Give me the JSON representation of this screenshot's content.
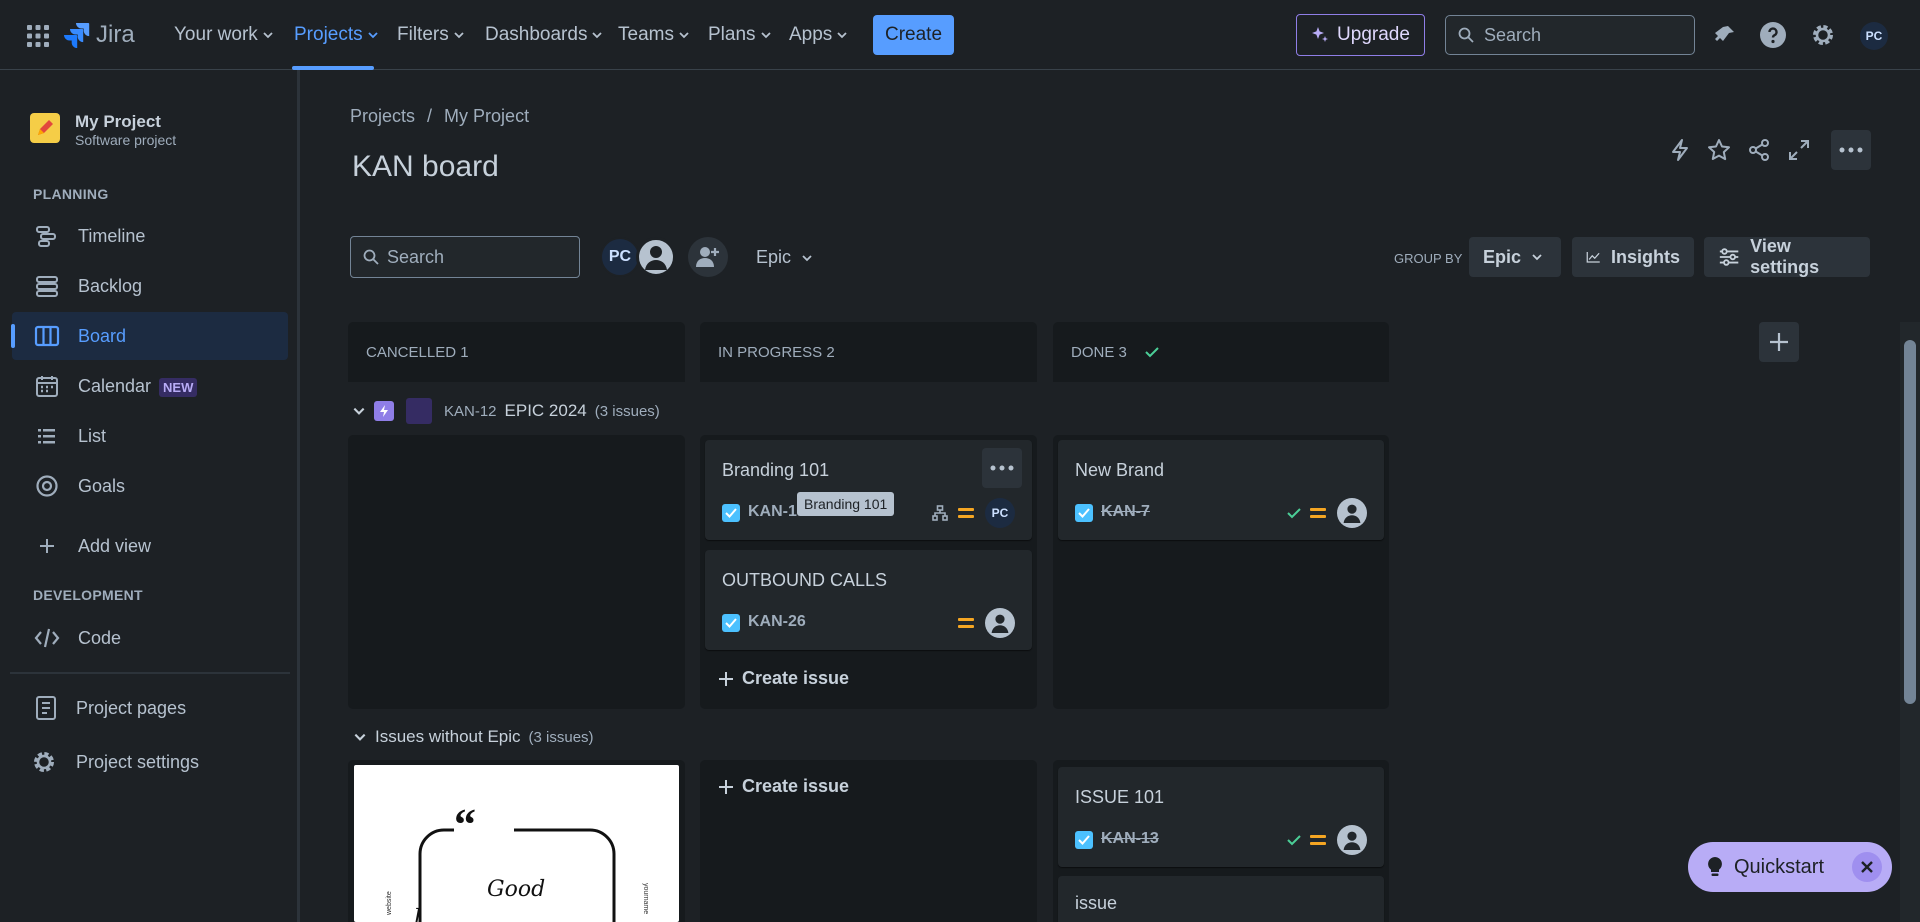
{
  "nav": {
    "product": "Jira",
    "items": [
      "Your work",
      "Projects",
      "Filters",
      "Dashboards",
      "Teams",
      "Plans",
      "Apps"
    ],
    "create": "Create",
    "upgrade": "Upgrade",
    "search_placeholder": "Search",
    "avatar": "PC"
  },
  "sidebar": {
    "project_name": "My Project",
    "project_type": "Software project",
    "planning_heading": "PLANNING",
    "planning_items": [
      "Timeline",
      "Backlog",
      "Board",
      "Calendar",
      "List",
      "Goals"
    ],
    "calendar_badge": "NEW",
    "add_view": "Add view",
    "development_heading": "DEVELOPMENT",
    "code": "Code",
    "project_pages": "Project pages",
    "project_settings": "Project settings"
  },
  "header": {
    "breadcrumb": [
      "Projects",
      "/",
      "My Project"
    ],
    "title": "KAN board"
  },
  "toolbar": {
    "search_placeholder": "Search",
    "avatar_initials": "PC",
    "epic_filter": "Epic",
    "group_by_label": "GROUP BY",
    "group_by_value": "Epic",
    "insights": "Insights",
    "view_settings": "View settings"
  },
  "board": {
    "columns": [
      "CANCELLED 1",
      "IN PROGRESS 2",
      "DONE 3"
    ],
    "epic_swimlane": {
      "key": "KAN-12",
      "name": "EPIC 2024",
      "count": "(3 issues)"
    },
    "noepic_swimlane": {
      "name": "Issues without Epic",
      "count": "(3 issues)"
    },
    "cards": {
      "branding": {
        "title": "Branding 101",
        "key": "KAN-16",
        "avatar": "PC"
      },
      "outbound": {
        "title": "OUTBOUND CALLS",
        "key": "KAN-26"
      },
      "newbrand": {
        "title": "New Brand",
        "key": "KAN-7"
      },
      "issue101": {
        "title": "ISSUE 101",
        "key": "KAN-13"
      },
      "issue": {
        "title": "issue"
      }
    },
    "tooltip": "Branding 101",
    "create_issue": "Create issue",
    "quote_text": "Good"
  },
  "quickstart": {
    "label": "Quickstart"
  },
  "colors": {
    "accent": "#579dff",
    "background": "#1d2125",
    "card": "#22272b",
    "column": "#161a1d",
    "epic": "#8f7ee7",
    "priority": "#f5a623",
    "done_check": "#4bce97"
  }
}
